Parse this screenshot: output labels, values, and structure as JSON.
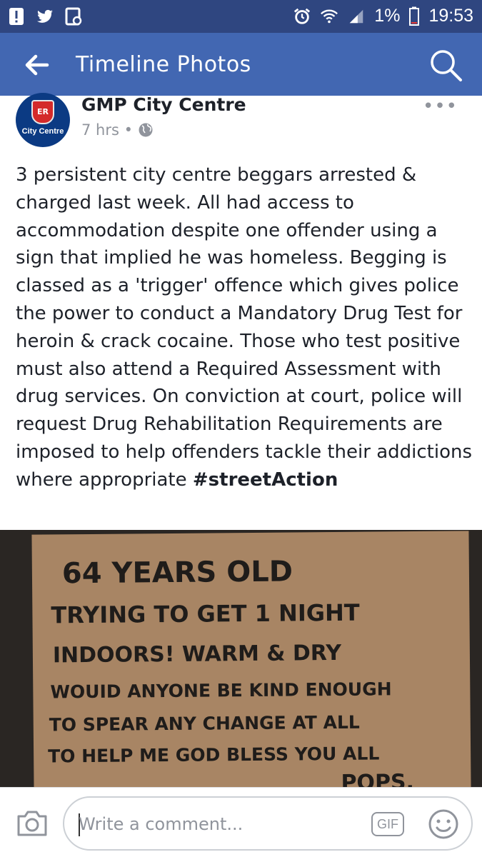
{
  "status_bar": {
    "battery": "1%",
    "time": "19:53"
  },
  "app_bar": {
    "title": "Timeline Photos"
  },
  "post": {
    "page_name": "GMP City Centre",
    "avatar_text": "City Centre",
    "avatar_badge": "ER",
    "time": "7 hrs",
    "more": "•••",
    "text": "3 persistent city centre beggars arrested & charged last week. All had access to accommodation despite one offender using a sign that implied he was homeless. Begging is classed as a 'trigger' offence which gives police the power to conduct a Mandatory Drug Test for heroin & crack cocaine. Those who test positive must also attend a Required Assessment with drug services. On conviction at court, police will request Drug Rehabilitation Requirements are imposed to help offenders tackle their addictions where appropriate ",
    "hashtag": "#streetAction"
  },
  "sign": {
    "lines": [
      "64 YEARS OLD",
      "TRYING TO GET 1 NIGHT",
      "INDOORS! WARM & DRY",
      "WOUID ANYONE BE KIND ENOUGH",
      "TO SPEAR ANY CHANGE AT ALL",
      "TO HELP ME GOD BLESS YOU ALL",
      "POPS."
    ]
  },
  "comment_bar": {
    "placeholder": "Write a comment...",
    "gif_label": "GIF"
  }
}
